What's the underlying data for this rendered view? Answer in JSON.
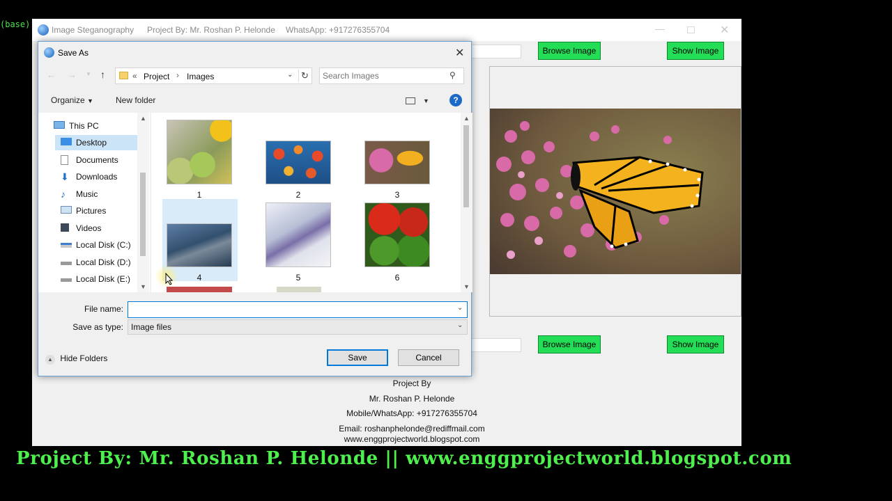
{
  "terminal": {
    "prompt": "(base)"
  },
  "app": {
    "title": "Image Steganography",
    "project_by": "Project By: Mr. Roshan P. Helonde",
    "whatsapp": "WhatsApp: +917276355704",
    "browse_label_top": "Browse Image",
    "show_label_top": "Show Image",
    "browse_label_bottom": "Browse Image",
    "show_label_bottom": "Show Image",
    "footer": {
      "line1": "Project By",
      "line2": "Mr. Roshan P. Helonde",
      "line3": "Mobile/WhatsApp: +917276355704",
      "line4": "Email: roshanphelonde@rediffmail.com",
      "line5": "www.enggprojectworld.blogspot.com"
    }
  },
  "dialog": {
    "title": "Save As",
    "breadcrumb": {
      "prefix": "«",
      "project": "Project",
      "images": "Images"
    },
    "search_placeholder": "Search Images",
    "organize_label": "Organize",
    "new_folder_label": "New folder",
    "nav": [
      {
        "label": "This PC"
      },
      {
        "label": "Desktop"
      },
      {
        "label": "Documents"
      },
      {
        "label": "Downloads"
      },
      {
        "label": "Music"
      },
      {
        "label": "Pictures"
      },
      {
        "label": "Videos"
      },
      {
        "label": "Local Disk (C:)"
      },
      {
        "label": "Local Disk (D:)"
      },
      {
        "label": "Local Disk (E:)"
      }
    ],
    "files": [
      {
        "name": "1"
      },
      {
        "name": "2"
      },
      {
        "name": "3"
      },
      {
        "name": "4"
      },
      {
        "name": "5"
      },
      {
        "name": "6"
      }
    ],
    "file_name_label": "File name:",
    "file_name_value": "",
    "save_type_label": "Save as type:",
    "save_type_value": "Image files",
    "hide_folders_label": "Hide Folders",
    "save_label": "Save",
    "cancel_label": "Cancel"
  },
  "banner": {
    "text": "Project By: Mr. Roshan P. Helonde ||  www.enggprojectworld.blogspot.com"
  },
  "colors": {
    "accent_green": "#22dd55",
    "banner_green": "#4ef04e",
    "selection_blue": "#cce4f7",
    "primary_button_border": "#0078d7"
  }
}
